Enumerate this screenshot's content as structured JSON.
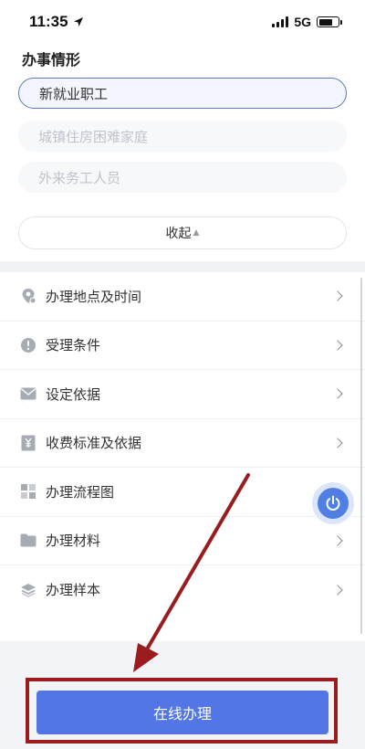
{
  "status_bar": {
    "time": "11:35",
    "network": "5G",
    "battery_level": 0.7
  },
  "section_title": "办事情形",
  "options": [
    {
      "label": "新就业职工",
      "selected": true
    },
    {
      "label": "城镇住房困难家庭",
      "selected": false
    },
    {
      "label": "外来务工人员",
      "selected": false
    }
  ],
  "collapse": {
    "label": "收起",
    "icon": "triangle-up-icon"
  },
  "menu": [
    {
      "label": "办理地点及时间",
      "icon": "location-pin-icon"
    },
    {
      "label": "受理条件",
      "icon": "alert-circle-icon"
    },
    {
      "label": "设定依据",
      "icon": "envelope-icon"
    },
    {
      "label": "收费标准及依据",
      "icon": "yen-document-icon"
    },
    {
      "label": "办理流程图",
      "icon": "grid-flow-icon"
    },
    {
      "label": "办理材料",
      "icon": "folder-icon"
    },
    {
      "label": "办理样本",
      "icon": "layers-icon"
    }
  ],
  "floating_button": {
    "icon": "power-icon"
  },
  "submit": {
    "label": "在线办理"
  },
  "colors": {
    "accent": "#5376e6",
    "selected_border": "#5f78b8",
    "annotation": "#9a1c1f",
    "icon_gray": "#a7abb4"
  }
}
